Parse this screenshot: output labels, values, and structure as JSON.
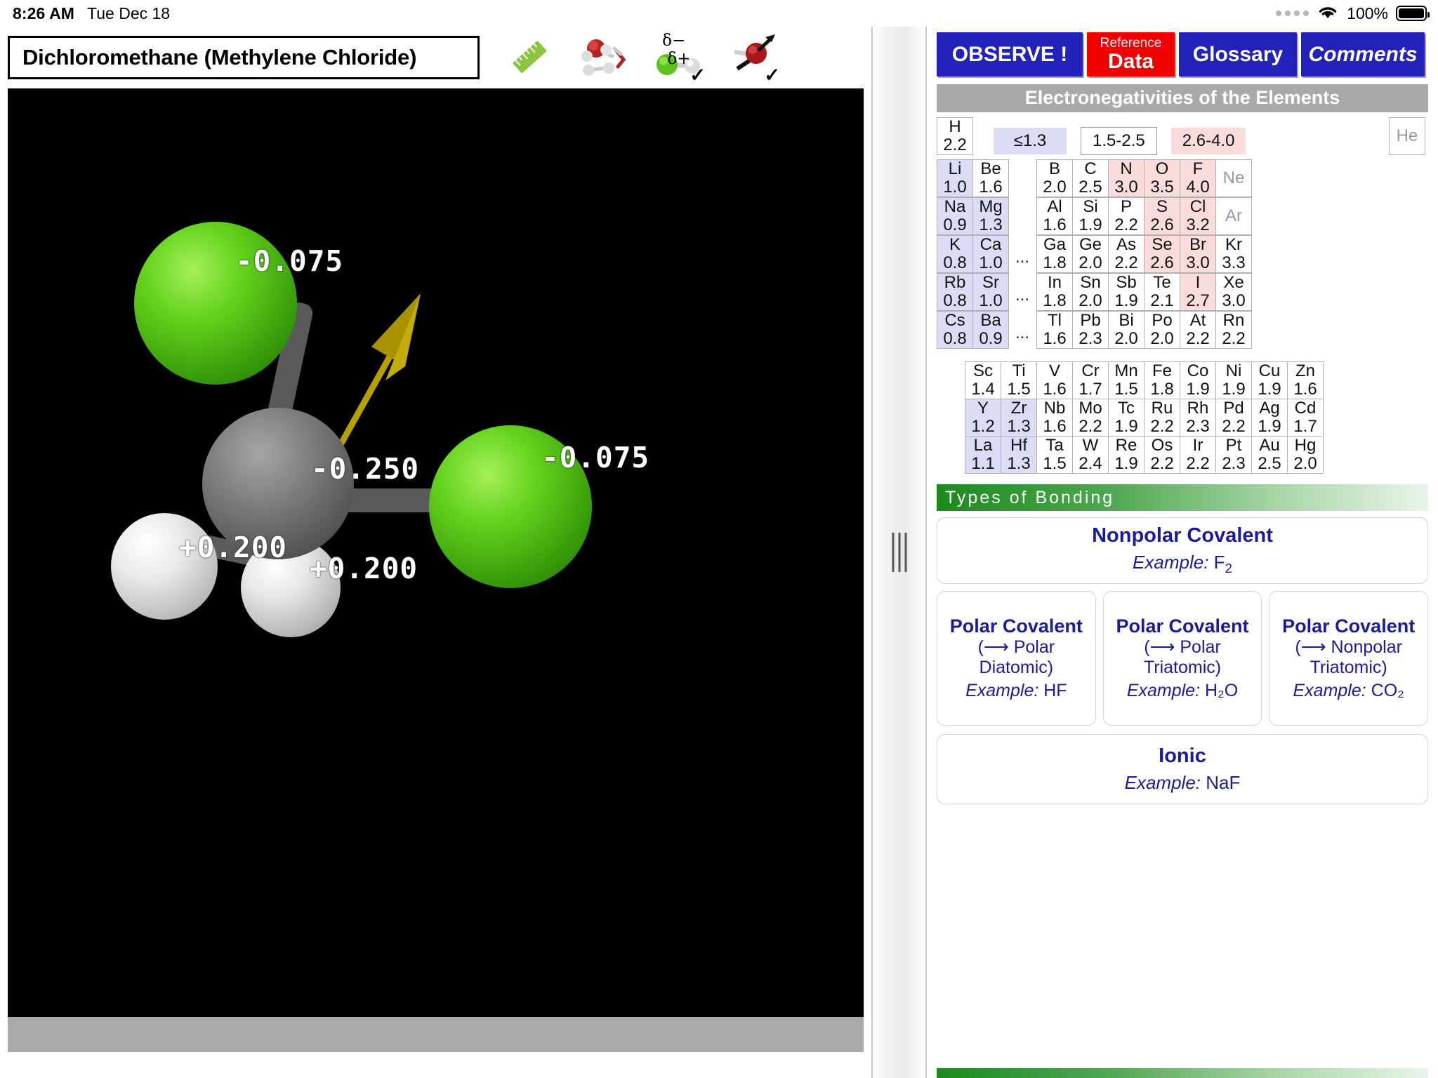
{
  "status_bar": {
    "time": "8:26 AM",
    "date": "Tue Dec 18",
    "battery_percent": "100%",
    "wifi_icon": "wifi-icon",
    "battery_icon": "battery-full-icon"
  },
  "left_pane": {
    "molecule_title": "Dichloromethane (Methylene Chloride)",
    "tools": [
      {
        "name": "ruler-measure-tool-icon",
        "checked": false
      },
      {
        "name": "water-molecules-icon",
        "checked": false
      },
      {
        "name": "partial-charges-icon",
        "checked": true,
        "delta_minus": "δ−",
        "delta_plus": "δ+",
        "tick": "✓"
      },
      {
        "name": "dipole-arrow-icon",
        "checked": true,
        "tick": "✓"
      }
    ],
    "viewer": {
      "background": "#000000",
      "charge_labels": [
        {
          "text": "-0.075",
          "atom": "chlorine-top"
        },
        {
          "text": "-0.250",
          "atom": "dipole-value"
        },
        {
          "text": "-0.075",
          "atom": "chlorine-right"
        },
        {
          "text": "+0.200",
          "atom": "hydrogen-left"
        },
        {
          "text": "+0.200",
          "atom": "hydrogen-bottom"
        }
      ],
      "atom_colors": {
        "chlorine": "#4cc417",
        "carbon": "#696969",
        "hydrogen": "#e8e8e8",
        "bond": "#5a5a5a",
        "dipole_arrow": "#b8a000"
      }
    }
  },
  "divider": {
    "name": "split-view-drag-handle"
  },
  "right_pane": {
    "nav_buttons": [
      {
        "label": "OBSERVE !",
        "color": "#2222bb"
      },
      {
        "label_top": "Reference",
        "label_bottom": "Data",
        "color": "#f00000"
      },
      {
        "label": "Glossary",
        "color": "#2222bb"
      },
      {
        "label": "Comments",
        "color": "#2222bb"
      }
    ],
    "electronegativity": {
      "title": "Electronegativities of the Elements",
      "hydrogen": {
        "sym": "H",
        "val": "2.2"
      },
      "helium": {
        "sym": "He",
        "val": ""
      },
      "legend": [
        {
          "text": "≤1.3",
          "color": "#dcdcf7"
        },
        {
          "text": "1.5-2.5",
          "color": "#ffffff"
        },
        {
          "text": "2.6-4.0",
          "color": "#fbdcdd"
        }
      ],
      "ellipsis": "...",
      "main_rows": [
        {
          "left": [
            {
              "sym": "Li",
              "val": "1.0",
              "c": "blue"
            },
            {
              "sym": "Be",
              "val": "1.6",
              "c": ""
            }
          ],
          "gap": "",
          "right": [
            {
              "sym": "B",
              "val": "2.0",
              "c": ""
            },
            {
              "sym": "C",
              "val": "2.5",
              "c": ""
            },
            {
              "sym": "N",
              "val": "3.0",
              "c": "pink"
            },
            {
              "sym": "O",
              "val": "3.5",
              "c": "pink"
            },
            {
              "sym": "F",
              "val": "4.0",
              "c": "pink"
            },
            {
              "sym": "Ne",
              "val": "",
              "c": "ghost"
            }
          ]
        },
        {
          "left": [
            {
              "sym": "Na",
              "val": "0.9",
              "c": "blue"
            },
            {
              "sym": "Mg",
              "val": "1.3",
              "c": "blue"
            }
          ],
          "gap": "",
          "right": [
            {
              "sym": "Al",
              "val": "1.6",
              "c": ""
            },
            {
              "sym": "Si",
              "val": "1.9",
              "c": ""
            },
            {
              "sym": "P",
              "val": "2.2",
              "c": ""
            },
            {
              "sym": "S",
              "val": "2.6",
              "c": "pink"
            },
            {
              "sym": "Cl",
              "val": "3.2",
              "c": "pink"
            },
            {
              "sym": "Ar",
              "val": "",
              "c": "ghost"
            }
          ]
        },
        {
          "left": [
            {
              "sym": "K",
              "val": "0.8",
              "c": "blue"
            },
            {
              "sym": "Ca",
              "val": "1.0",
              "c": "blue"
            }
          ],
          "gap": "...",
          "right": [
            {
              "sym": "Ga",
              "val": "1.8",
              "c": ""
            },
            {
              "sym": "Ge",
              "val": "2.0",
              "c": ""
            },
            {
              "sym": "As",
              "val": "2.2",
              "c": ""
            },
            {
              "sym": "Se",
              "val": "2.6",
              "c": "pink"
            },
            {
              "sym": "Br",
              "val": "3.0",
              "c": "pink"
            },
            {
              "sym": "Kr",
              "val": "3.3",
              "c": ""
            }
          ]
        },
        {
          "left": [
            {
              "sym": "Rb",
              "val": "0.8",
              "c": "blue"
            },
            {
              "sym": "Sr",
              "val": "1.0",
              "c": "blue"
            }
          ],
          "gap": "...",
          "right": [
            {
              "sym": "In",
              "val": "1.8",
              "c": ""
            },
            {
              "sym": "Sn",
              "val": "2.0",
              "c": ""
            },
            {
              "sym": "Sb",
              "val": "1.9",
              "c": ""
            },
            {
              "sym": "Te",
              "val": "2.1",
              "c": ""
            },
            {
              "sym": "I",
              "val": "2.7",
              "c": "pink"
            },
            {
              "sym": "Xe",
              "val": "3.0",
              "c": ""
            }
          ]
        },
        {
          "left": [
            {
              "sym": "Cs",
              "val": "0.8",
              "c": "blue"
            },
            {
              "sym": "Ba",
              "val": "0.9",
              "c": "blue"
            }
          ],
          "gap": "...",
          "right": [
            {
              "sym": "Tl",
              "val": "1.6",
              "c": ""
            },
            {
              "sym": "Pb",
              "val": "2.3",
              "c": ""
            },
            {
              "sym": "Bi",
              "val": "2.0",
              "c": ""
            },
            {
              "sym": "Po",
              "val": "2.0",
              "c": ""
            },
            {
              "sym": "At",
              "val": "2.2",
              "c": ""
            },
            {
              "sym": "Rn",
              "val": "2.2",
              "c": ""
            }
          ]
        }
      ],
      "transition_rows": [
        [
          {
            "sym": "Sc",
            "val": "1.4",
            "c": ""
          },
          {
            "sym": "Ti",
            "val": "1.5",
            "c": ""
          },
          {
            "sym": "V",
            "val": "1.6",
            "c": ""
          },
          {
            "sym": "Cr",
            "val": "1.7",
            "c": ""
          },
          {
            "sym": "Mn",
            "val": "1.5",
            "c": ""
          },
          {
            "sym": "Fe",
            "val": "1.8",
            "c": ""
          },
          {
            "sym": "Co",
            "val": "1.9",
            "c": ""
          },
          {
            "sym": "Ni",
            "val": "1.9",
            "c": ""
          },
          {
            "sym": "Cu",
            "val": "1.9",
            "c": ""
          },
          {
            "sym": "Zn",
            "val": "1.6",
            "c": ""
          }
        ],
        [
          {
            "sym": "Y",
            "val": "1.2",
            "c": "blue"
          },
          {
            "sym": "Zr",
            "val": "1.3",
            "c": "blue"
          },
          {
            "sym": "Nb",
            "val": "1.6",
            "c": ""
          },
          {
            "sym": "Mo",
            "val": "2.2",
            "c": ""
          },
          {
            "sym": "Tc",
            "val": "1.9",
            "c": ""
          },
          {
            "sym": "Ru",
            "val": "2.2",
            "c": ""
          },
          {
            "sym": "Rh",
            "val": "2.3",
            "c": ""
          },
          {
            "sym": "Pd",
            "val": "2.2",
            "c": ""
          },
          {
            "sym": "Ag",
            "val": "1.9",
            "c": ""
          },
          {
            "sym": "Cd",
            "val": "1.7",
            "c": ""
          }
        ],
        [
          {
            "sym": "La",
            "val": "1.1",
            "c": "blue"
          },
          {
            "sym": "Hf",
            "val": "1.3",
            "c": "blue"
          },
          {
            "sym": "Ta",
            "val": "1.5",
            "c": ""
          },
          {
            "sym": "W",
            "val": "2.4",
            "c": ""
          },
          {
            "sym": "Re",
            "val": "1.9",
            "c": ""
          },
          {
            "sym": "Os",
            "val": "2.2",
            "c": ""
          },
          {
            "sym": "Ir",
            "val": "2.2",
            "c": ""
          },
          {
            "sym": "Pt",
            "val": "2.3",
            "c": ""
          },
          {
            "sym": "Au",
            "val": "2.5",
            "c": ""
          },
          {
            "sym": "Hg",
            "val": "2.0",
            "c": ""
          }
        ]
      ]
    },
    "bonding": {
      "title": "Types of Bonding",
      "nonpolar": {
        "title": "Nonpolar Covalent",
        "example_label": "Example:",
        "example_formula": "F",
        "example_sub": "2"
      },
      "cards": [
        {
          "title": "Polar Covalent",
          "sub": "(⟶ Polar Diatomic)",
          "example_label": "Example:",
          "example_formula": "HF",
          "example_sub": ""
        },
        {
          "title": "Polar Covalent",
          "sub": "(⟶ Polar Triatomic)",
          "example_label": "Example:",
          "example_formula": "H₂O",
          "example_sub": ""
        },
        {
          "title": "Polar Covalent",
          "sub": "(⟶ Nonpolar Triatomic)",
          "example_label": "Example:",
          "example_formula": "CO₂",
          "example_sub": ""
        }
      ],
      "ionic": {
        "title": "Ionic",
        "example_label": "Example:",
        "example_formula": "NaF"
      }
    }
  }
}
